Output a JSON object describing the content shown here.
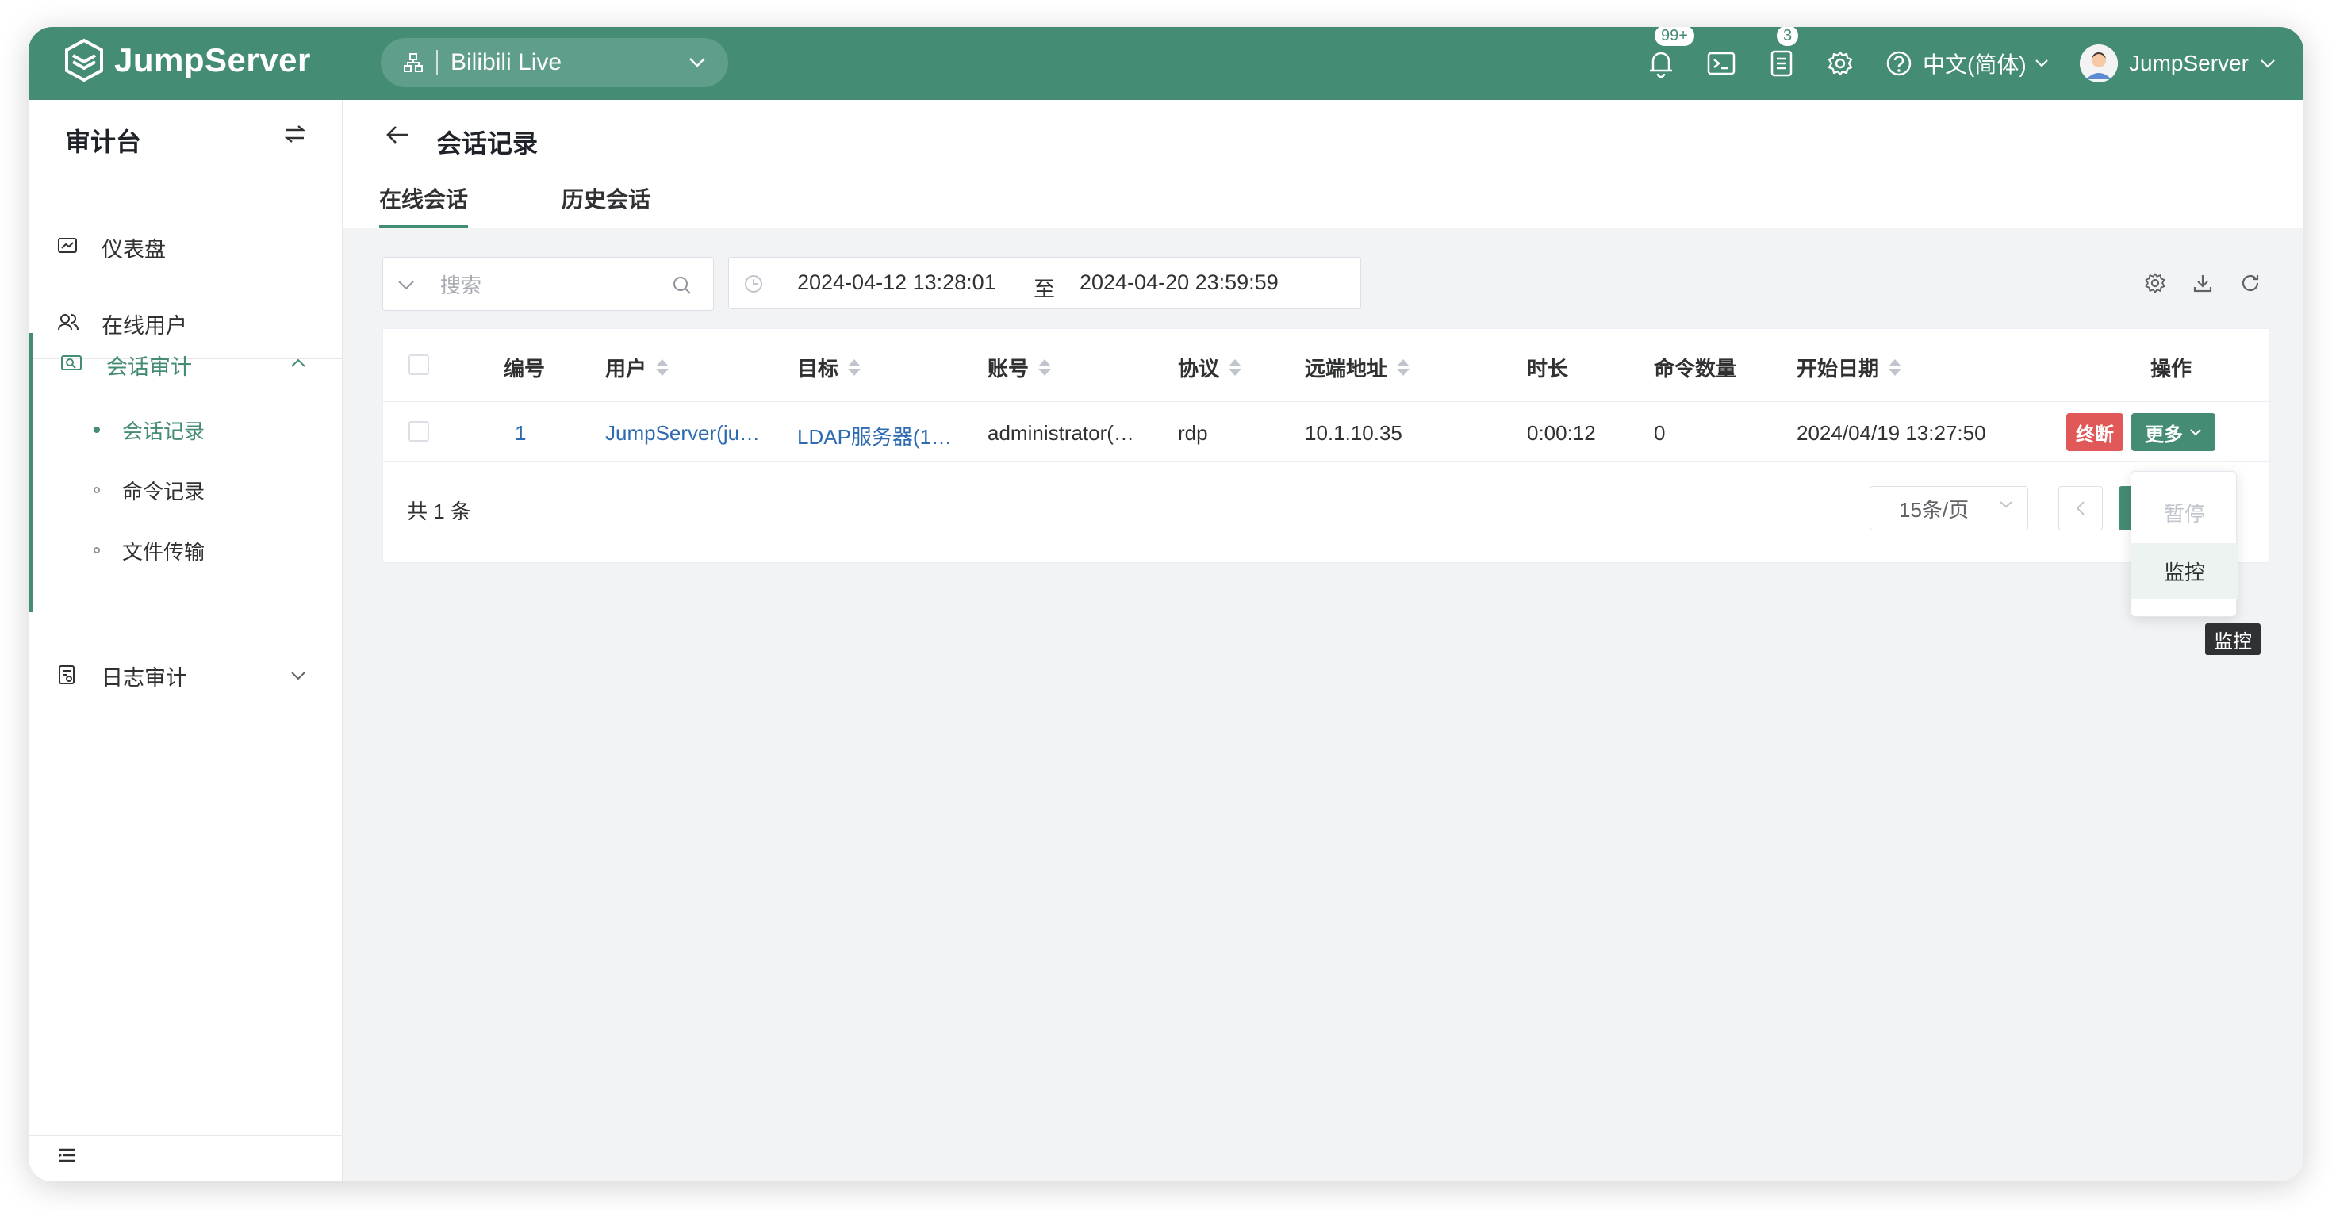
{
  "header": {
    "logo_text": "JumpServer",
    "org_name": "Bilibili Live",
    "notification_badge": "99+",
    "tasks_badge": "3",
    "language": "中文(简体)",
    "username": "JumpServer"
  },
  "sidebar": {
    "title": "审计台",
    "items": [
      {
        "label": "仪表盘",
        "icon": "dashboard-icon"
      },
      {
        "label": "在线用户",
        "icon": "users-icon"
      },
      {
        "label": "会话审计",
        "icon": "session-icon"
      },
      {
        "label": "日志审计",
        "icon": "log-icon"
      }
    ],
    "sub_items": [
      {
        "label": "会话记录"
      },
      {
        "label": "命令记录"
      },
      {
        "label": "文件传输"
      }
    ]
  },
  "page": {
    "title": "会话记录",
    "tabs": [
      {
        "label": "在线会话"
      },
      {
        "label": "历史会话"
      }
    ]
  },
  "filters": {
    "search_placeholder": "搜索",
    "date_from": "2024-04-12 13:28:01",
    "date_sep": "至",
    "date_to": "2024-04-20 23:59:59"
  },
  "table": {
    "columns": [
      "编号",
      "用户",
      "目标",
      "账号",
      "协议",
      "远端地址",
      "时长",
      "命令数量",
      "开始日期",
      "操作"
    ],
    "rows": [
      {
        "id": "1",
        "user": "JumpServer(ju…",
        "target": "LDAP服务器(1…",
        "account": "administrator(…",
        "protocol": "rdp",
        "remote_addr": "10.1.10.35",
        "duration": "0:00:12",
        "command_count": "0",
        "start_date": "2024/04/19 13:27:50",
        "terminate_label": "终断",
        "more_label": "更多"
      }
    ],
    "total": "共 1 条",
    "page_size": "15条/页"
  },
  "dropdown": {
    "items": [
      {
        "label": "暂停",
        "disabled": true
      },
      {
        "label": "监控",
        "disabled": false
      }
    ],
    "tooltip": "监控"
  },
  "colors": {
    "brand": "#458c75",
    "danger": "#e05858",
    "link": "#2e6ab1"
  }
}
